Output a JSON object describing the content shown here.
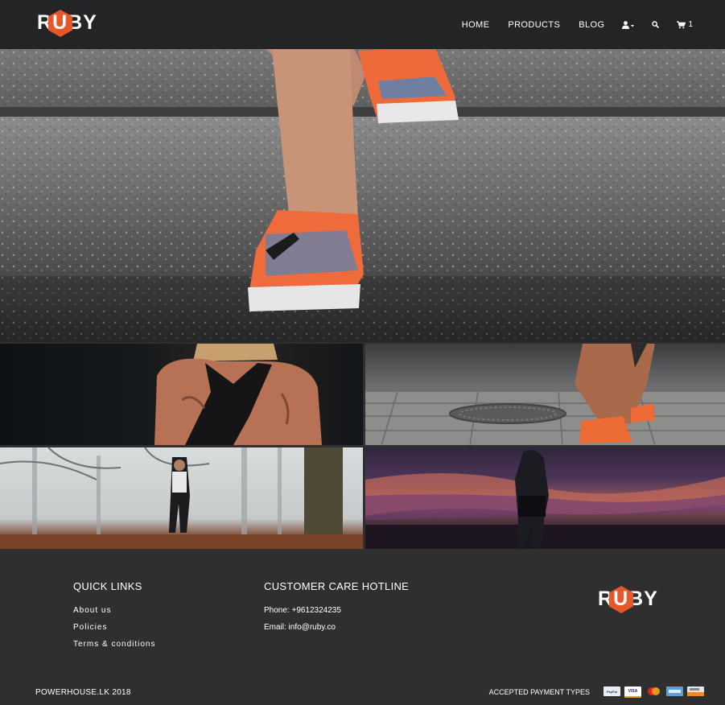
{
  "brand": {
    "name": "RUBY",
    "left_letter": "R",
    "hex_letter": "U",
    "right_letters": "BY",
    "accent": "#e8572a"
  },
  "nav": {
    "items": [
      "HOME",
      "PRODUCTS",
      "BLOG"
    ],
    "account_icon": "user-dropdown-icon",
    "search_icon": "search-icon",
    "cart_icon": "cart-icon",
    "cart_count": "1"
  },
  "footer": {
    "quick_links": {
      "title": "QUICK LINKS",
      "items": [
        "About us",
        "Policies",
        "Terms & conditions"
      ]
    },
    "customer_care": {
      "title": "CUSTOMER CARE HOTLINE",
      "phone": "Phone: +9612324235",
      "email": "Email: info@ruby.co"
    },
    "copyright": "POWERHOUSE.LK 2018",
    "payment_label": "ACCEPTED PAYMENT TYPES",
    "payment_cards": [
      "PayPal",
      "VISA",
      "MasterCard",
      "American Express",
      "Discover"
    ]
  },
  "colors": {
    "header_bg": "#232425",
    "footer_bg": "#2f2f30"
  }
}
